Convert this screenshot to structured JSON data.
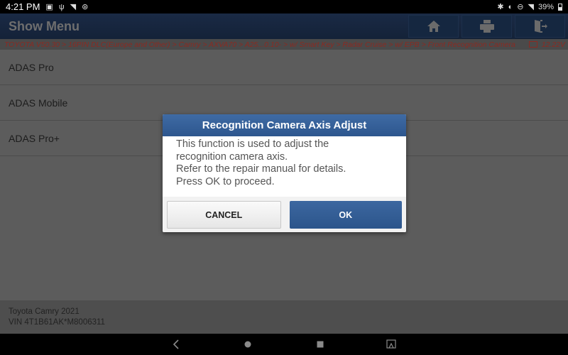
{
  "status_bar": {
    "time": "4:21 PM",
    "left_icons": [
      "image-icon",
      "usb-debug-icon",
      "wifi-weak-icon",
      "accessibility-icon"
    ],
    "right_icons": [
      "bluetooth-icon",
      "vibrate-icon",
      "do-not-disturb-icon",
      "wifi-icon"
    ],
    "battery_percent": "39%"
  },
  "header": {
    "title": "Show Menu",
    "buttons": [
      {
        "name": "home",
        "icon": "home-icon"
      },
      {
        "name": "print",
        "icon": "printer-icon"
      },
      {
        "name": "exit",
        "icon": "exit-icon"
      }
    ]
  },
  "breadcrumb": {
    "path": "TOYOTA V50.30 > 16PIN DLC(Europe and Other) > Camry > AXVA70 > A25...0.10- > w/ Smart Key > Radar Cruise > w/ EPB > Front Recognition Camera",
    "voltage": "12.22V"
  },
  "menu": {
    "items": [
      {
        "label": "ADAS Pro"
      },
      {
        "label": "ADAS Mobile"
      },
      {
        "label": "ADAS Pro+"
      }
    ]
  },
  "vehicle": {
    "model": "Toyota Camry 2021",
    "vin": "VIN 4T1B61AK*M8006311"
  },
  "dialog": {
    "title": "Recognition Camera Axis Adjust",
    "lines": [
      "This function is used to adjust the",
      "recognition camera axis.",
      "Refer to the repair manual for details.",
      "Press OK to proceed."
    ],
    "cancel_label": "CANCEL",
    "ok_label": "OK"
  },
  "colors": {
    "header_bg": "#142238",
    "dialog_accent": "#2d568e",
    "breadcrumb_text": "#8b2a22"
  }
}
